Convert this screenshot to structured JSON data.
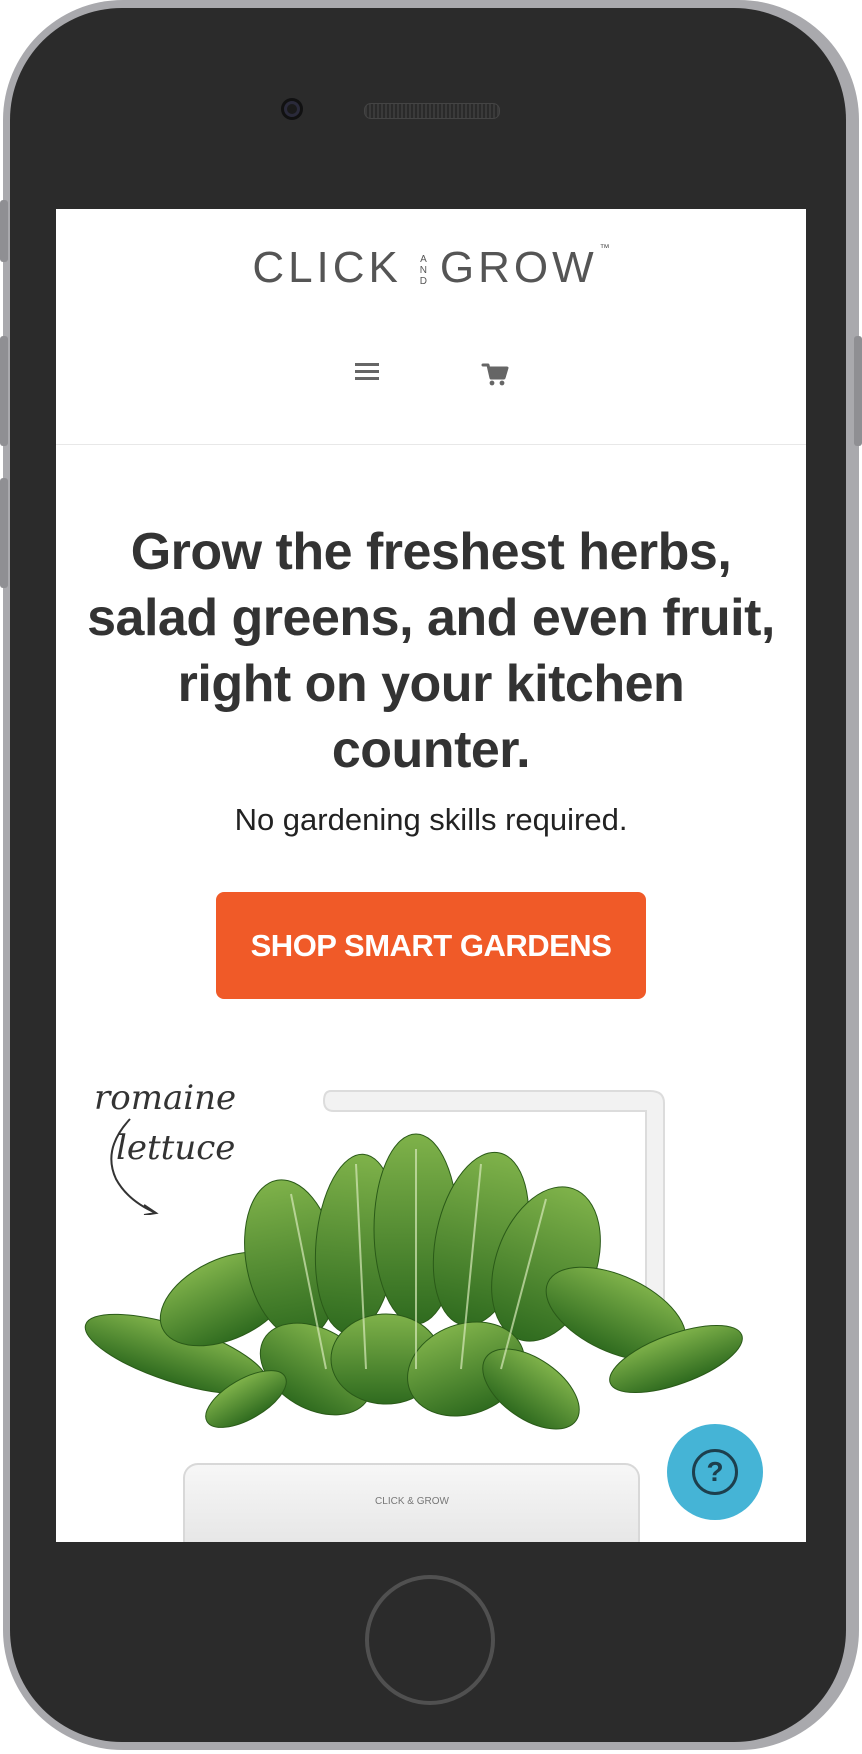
{
  "header": {
    "logo": {
      "left": "CLICK",
      "and": "AND",
      "right": "GROW",
      "tm": "™"
    },
    "menu_icon": "hamburger-menu-icon",
    "cart_icon": "shopping-cart-icon"
  },
  "hero": {
    "title": "Grow the freshest herbs, salad greens, and even fruit, right on your kitchen counter.",
    "subtitle": "No gardening skills required.",
    "cta_label": "SHOP SMART GARDENS"
  },
  "product_image": {
    "annotation_line1": "romaine",
    "annotation_line2": "lettuce",
    "planter_brand": "CLICK & GROW"
  },
  "help": {
    "icon": "question-mark-icon",
    "glyph": "?"
  },
  "colors": {
    "accent": "#f05a28",
    "help": "#45b4d6",
    "text": "#333333",
    "phone_body": "#2b2b2b",
    "phone_frame": "#a9a9ad"
  }
}
